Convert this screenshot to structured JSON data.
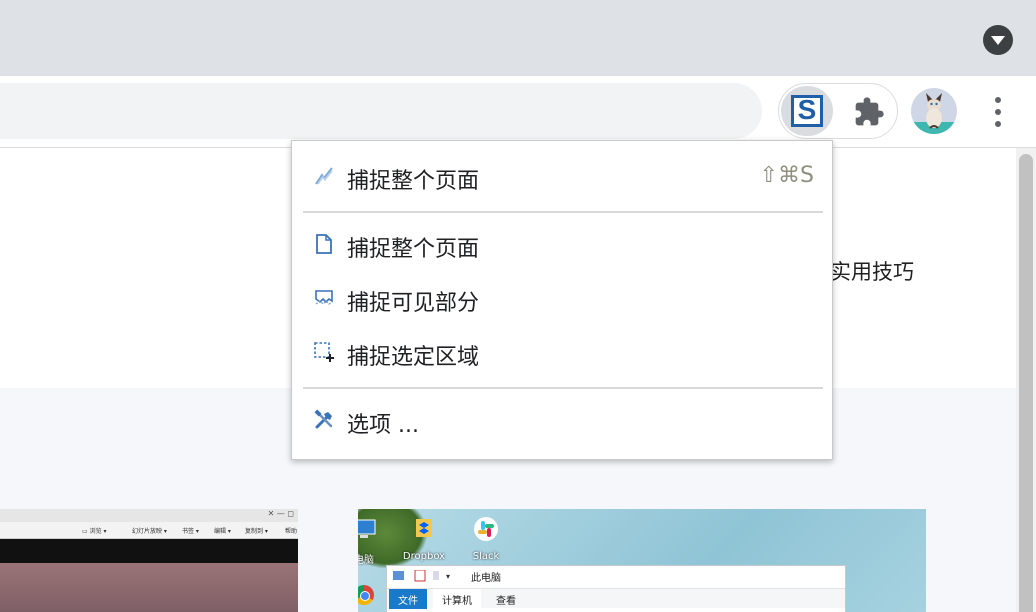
{
  "browser": {
    "tab_search_icon": "tab-search-icon",
    "extensions": {
      "active_extension": {
        "name": "Snagit",
        "glyph": "S",
        "accent": "#1f5fa8"
      },
      "puzzle_icon": "puzzle-icon"
    },
    "menu_icon": "more-vert-icon"
  },
  "page": {
    "heading_partial": "实用技巧"
  },
  "thumbnail_left": {
    "window_controls": "✕ — ◻",
    "ribbon_items": [
      "▭ 浏览 ▾",
      "幻灯片放映 ▾",
      "书签 ▾",
      "编辑 ▾",
      "复制到 ▾",
      "帮助"
    ]
  },
  "thumbnail_right": {
    "desktop_icons": [
      {
        "label": "此电脑",
        "shown": "电脑"
      },
      {
        "label": "Dropbox"
      },
      {
        "label": "Slack"
      }
    ],
    "explorer": {
      "title": "此电脑",
      "tabs": [
        "文件",
        "计算机",
        "查看"
      ]
    }
  },
  "menu": {
    "items": [
      {
        "label": "捕捉整个页面",
        "shortcut": "⇧⌘S",
        "icon": "lightning-capture-icon"
      },
      {
        "label": "捕捉整个页面",
        "icon": "page-icon"
      },
      {
        "label": "捕捉可见部分",
        "icon": "visible-area-icon"
      },
      {
        "label": "捕捉选定区域",
        "icon": "selection-area-icon"
      },
      {
        "label": "选项 ...",
        "icon": "tools-icon"
      }
    ]
  }
}
